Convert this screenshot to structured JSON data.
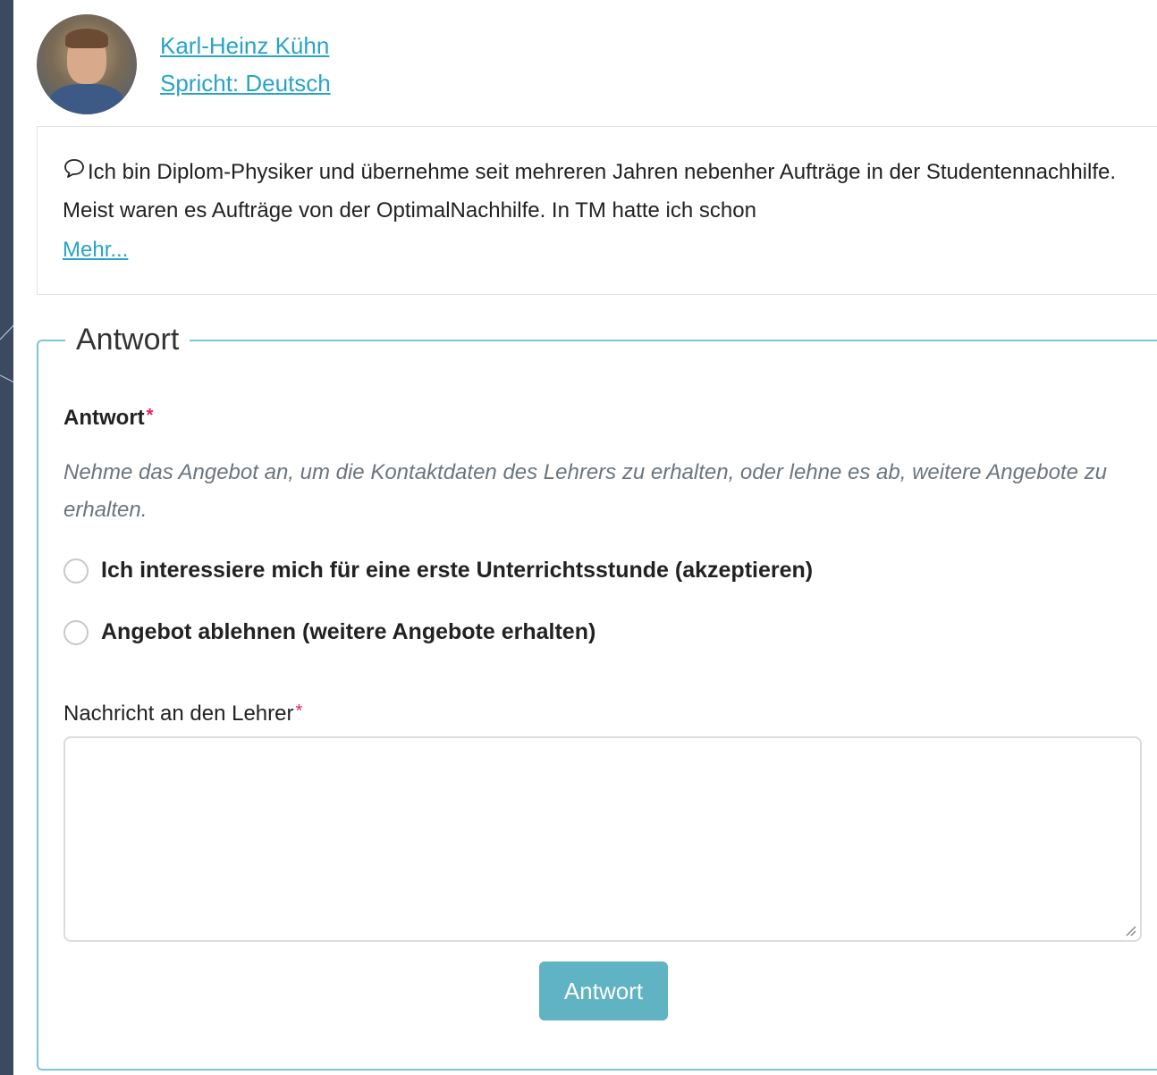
{
  "teacher": {
    "name": "Karl-Heinz Kühn",
    "languages": "Spricht: Deutsch"
  },
  "bio": {
    "text": "Ich bin Diplom-Physiker und übernehme seit mehreren Jahren nebenher Aufträge in der Studentennachhilfe. Meist waren es Aufträge von der OptimalNachhilfe. In TM hatte ich schon",
    "more_label": "Mehr..."
  },
  "response_form": {
    "legend": "Antwort",
    "answer_label": "Antwort",
    "required_mark": "*",
    "hint": "Nehme das Angebot an, um die Kontaktdaten des Lehrers zu erhalten, oder lehne es ab, weitere Angebote zu erhalten.",
    "options": [
      {
        "label": "Ich interessiere mich für eine erste Unterrichtsstunde (akzeptieren)"
      },
      {
        "label": "Angebot ablehnen (weitere Angebote erhalten)"
      }
    ],
    "message_label": "Nachricht an den Lehrer",
    "message_value": "",
    "submit_label": "Antwort"
  },
  "colors": {
    "link": "#2aa3c9",
    "button": "#5fb3c3",
    "required": "#e0245e",
    "fieldset_border": "#7fc4dd",
    "background": "#3b4a5e"
  }
}
